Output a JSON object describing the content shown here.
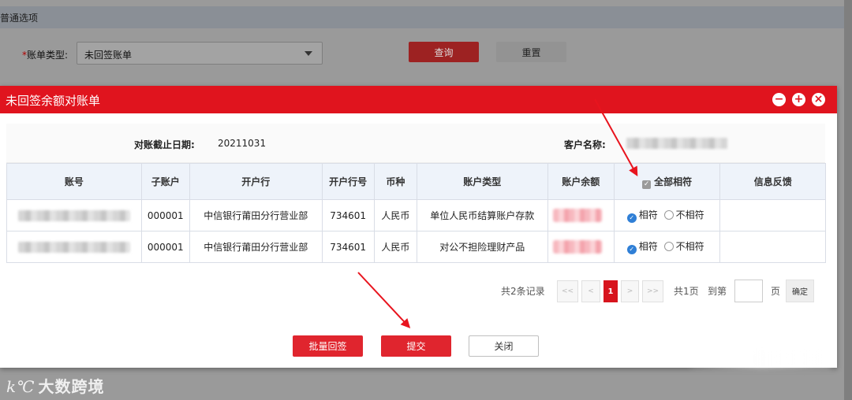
{
  "background": {
    "section_title": "普通选项",
    "form": {
      "label": "账单类型:",
      "required_mark": "*",
      "select_value": "未回签账单"
    },
    "query_button": "查询",
    "reset_button": "重置"
  },
  "modal": {
    "title": "未回签余额对账单",
    "info": {
      "date_label": "对账截止日期:",
      "date_value": "20211031",
      "customer_label": "客户名称:"
    },
    "table": {
      "headers": [
        "账号",
        "子账户",
        "开户行",
        "开户行号",
        "币种",
        "账户类型",
        "账户余额",
        "全部相符",
        "信息反馈"
      ],
      "rows": [
        {
          "sub_account": "000001",
          "bank": "中信银行莆田分行营业部",
          "bank_no": "734601",
          "currency": "人民币",
          "account_type": "单位人民币结算账户存款",
          "match_label": "相符",
          "mismatch_label": "不相符"
        },
        {
          "sub_account": "000001",
          "bank": "中信银行莆田分行营业部",
          "bank_no": "734601",
          "currency": "人民币",
          "account_type": "对公不担险理财产品",
          "match_label": "相符",
          "mismatch_label": "不相符"
        }
      ]
    },
    "pager": {
      "total": "共2条记录",
      "first": "<<",
      "prev": "<",
      "current": "1",
      "next": ">",
      "last": ">>",
      "pages": "共1页",
      "goto": "到第",
      "page_unit": "页",
      "confirm": "确定"
    },
    "buttons": {
      "batch_sign": "批量回签",
      "submit": "提交",
      "close": "关闭"
    }
  },
  "watermark": {
    "logo": "k℃",
    "text": "大数跨境"
  },
  "colors": {
    "header_red": "#e0141e",
    "button_red": "#e0252e",
    "radio_blue": "#2f7fd6"
  }
}
